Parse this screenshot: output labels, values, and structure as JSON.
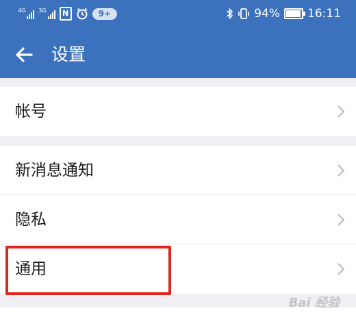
{
  "status_bar": {
    "sim1_type": "4G",
    "sim2_type": "3G",
    "nfc_label": "N",
    "notification_badge": "9+",
    "battery_percent": "94%",
    "battery_level": 0.94,
    "time": "16:11"
  },
  "app_bar": {
    "title": "设置",
    "back_icon": "arrow-left-icon"
  },
  "settings": {
    "group1": [
      {
        "label": "帐号",
        "icon": "chevron-right-icon"
      }
    ],
    "group2": [
      {
        "label": "新消息通知",
        "icon": "chevron-right-icon"
      },
      {
        "label": "隐私",
        "icon": "chevron-right-icon"
      },
      {
        "label": "通用",
        "icon": "chevron-right-icon"
      }
    ]
  },
  "watermark": "Bai 经验",
  "colors": {
    "header": "#3c72bd",
    "highlight": "#e1251b",
    "background": "#efeff4"
  }
}
